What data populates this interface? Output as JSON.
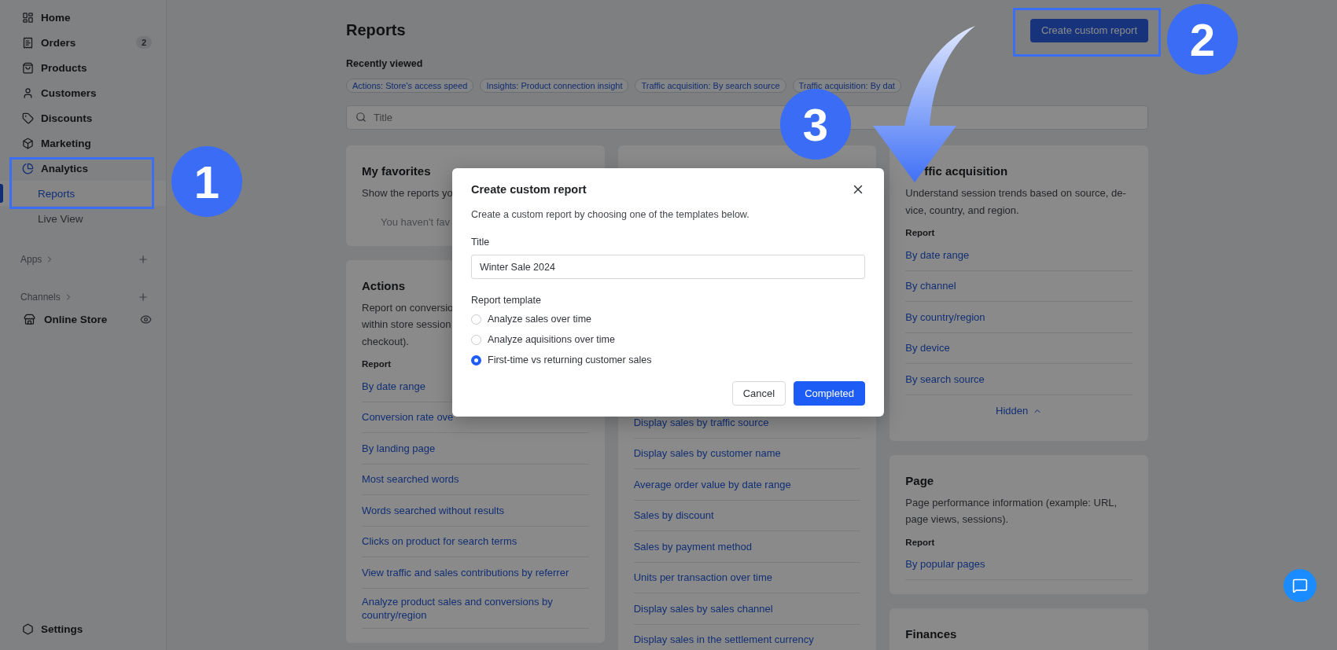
{
  "sidebar": {
    "nav": [
      {
        "label": "Home",
        "selected": false
      },
      {
        "label": "Orders",
        "selected": false,
        "badge": "2"
      },
      {
        "label": "Products",
        "selected": false
      },
      {
        "label": "Customers",
        "selected": false
      },
      {
        "label": "Discounts",
        "selected": false
      },
      {
        "label": "Marketing",
        "selected": false
      },
      {
        "label": "Analytics",
        "selected": false,
        "children": [
          {
            "label": "Reports",
            "selected": true
          },
          {
            "label": "Live View",
            "selected": false
          }
        ]
      }
    ],
    "sections": [
      {
        "label": "Apps"
      },
      {
        "label": "Channels",
        "items": [
          {
            "label": "Online Store"
          }
        ]
      }
    ],
    "footer": {
      "label": "Settings"
    }
  },
  "header": {
    "title": "Reports",
    "button": "Create custom report"
  },
  "recently_viewed": {
    "label": "Recently viewed",
    "chips": [
      "Actions: Store's access speed",
      "Insights: Product connection insight",
      "Traffic acquisition: By search source",
      "Traffic acquisition: By dat"
    ]
  },
  "search": {
    "placeholder": "Title"
  },
  "columns": [
    {
      "cards": [
        {
          "kind": "normal",
          "title": "My favorites",
          "description": "Show the reports yo",
          "empty": "You haven't fav"
        },
        {
          "kind": "normal",
          "title": "Actions",
          "description": "Report on conversio\nwithin store session\ncheckout).",
          "report_label": "Report",
          "links": [
            "By date range",
            "Conversion rate ove",
            "By landing page",
            "Most searched words",
            "Words searched without results",
            "Clicks on product for search terms",
            "View traffic and sales contributions by referrer",
            "Analyze product sales and conversions by country/region"
          ]
        }
      ]
    },
    {
      "cards": [
        {
          "kind": "covered",
          "links": [
            "Display sales by traffic source",
            "Display sales by customer name",
            "Average order value by date range",
            "Sales by discount",
            "Sales by payment method",
            "Units per transaction over time",
            "Display sales by sales channel",
            "Display sales in the settlement currency"
          ]
        }
      ]
    },
    {
      "cards": [
        {
          "kind": "title_covered",
          "title": "ffic acquisition",
          "description": "Understand session trends based on source, de-vice, country, and region.",
          "report_label": "Report",
          "links": [
            "By date range",
            "By channel",
            "By country/region",
            "By device",
            "By search source"
          ],
          "toggle": {
            "label": "Hidden",
            "expanded": true
          }
        },
        {
          "kind": "normal",
          "title": "Page",
          "description": "Page performance information (example: URL, page views, sessions).",
          "report_label": "Report",
          "links": [
            "By popular pages"
          ]
        },
        {
          "kind": "normal",
          "title": "Finances"
        }
      ]
    }
  ],
  "modal": {
    "title": "Create custom report",
    "description": "Create a custom report by choosing one of the templates below.",
    "title_label": "Title",
    "title_value": "Winter Sale 2024",
    "template_label": "Report template",
    "template_options": [
      {
        "label": "Analyze sales over time",
        "selected": false
      },
      {
        "label": "Analyze aquisitions over time",
        "selected": false
      },
      {
        "label": "First-time vs returning customer sales",
        "selected": true
      }
    ],
    "buttons": [
      {
        "label": "Cancel",
        "kind": "secondary"
      },
      {
        "label": "Completed",
        "kind": "primary"
      }
    ]
  },
  "annotations": [
    {
      "label": "1"
    },
    {
      "label": "2"
    },
    {
      "label": "3"
    }
  ]
}
